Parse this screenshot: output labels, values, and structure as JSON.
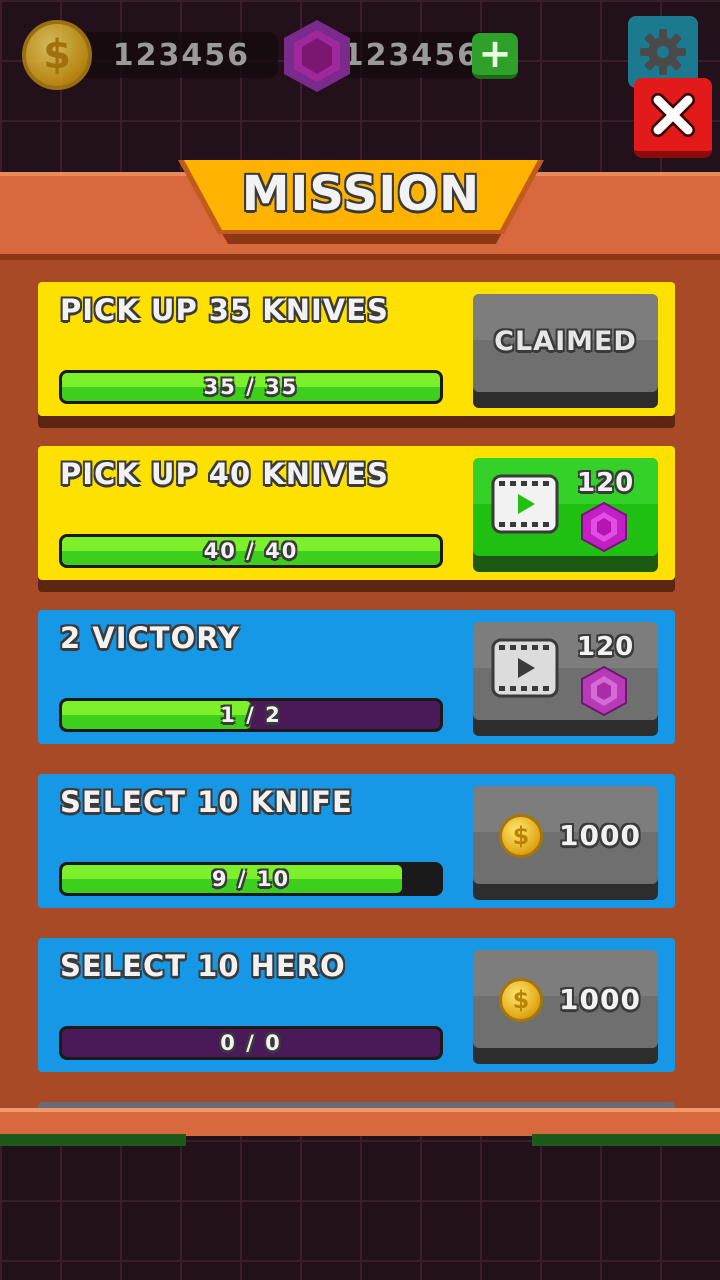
{
  "hud": {
    "coins": "123456",
    "gems": "123456",
    "coin_symbol": "$",
    "plus_symbol": "+"
  },
  "title": "MISSION",
  "missions": [
    {
      "title": "PICK UP 35 KNIVES",
      "progress": "35 / 35",
      "fraction": 1.0,
      "reward_type": "claimed",
      "reward_label": "CLAIMED",
      "theme": "yellow"
    },
    {
      "title": "PICK UP 40 KNIVES",
      "progress": "40 / 40",
      "fraction": 1.0,
      "reward_type": "video-gem",
      "reward_amount": "120",
      "state": "active",
      "theme": "yellow"
    },
    {
      "title": "2 VICTORY",
      "progress": "1 / 2",
      "fraction": 0.5,
      "reward_type": "video-gem",
      "reward_amount": "120",
      "state": "locked",
      "theme": "blue"
    },
    {
      "title": "SELECT  10 KNIFE",
      "progress": "9 / 10",
      "fraction": 0.9,
      "reward_type": "coin",
      "reward_amount": "1000",
      "coin_symbol": "$",
      "state": "locked",
      "theme": "blue"
    },
    {
      "title": "SELECT  10 HERO",
      "progress": "0 / 0",
      "fraction": 0.0,
      "reward_type": "coin",
      "reward_amount": "1000",
      "coin_symbol": "$",
      "state": "locked",
      "theme": "blue"
    }
  ],
  "colors": {
    "panel": "#a84a26",
    "banner": "#ffb300",
    "card_yellow": "#ffe100",
    "card_blue": "#1798e6",
    "bar_fill": "#5fe022",
    "bar_empty_purple": "#4a1a58",
    "bar_empty_black": "#1a1a1a"
  },
  "icons": [
    "coin-icon",
    "gem-icon",
    "plus-icon",
    "gear-icon",
    "close-icon",
    "video-icon"
  ]
}
